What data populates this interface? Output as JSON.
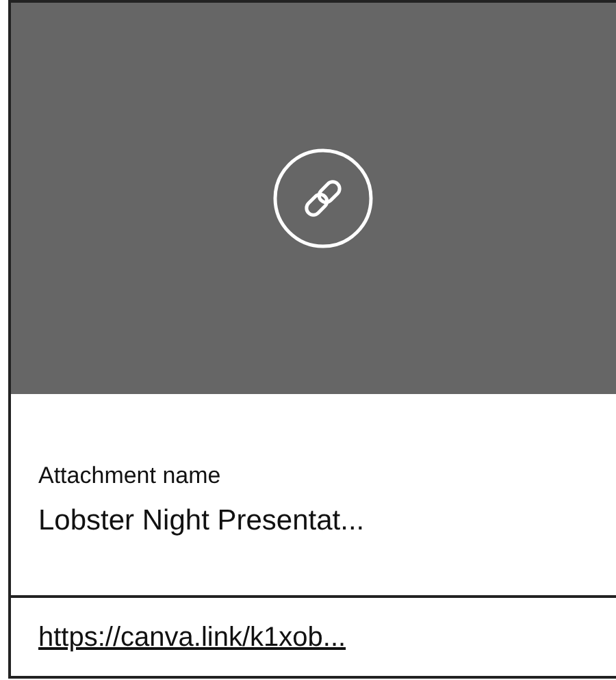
{
  "attachment": {
    "label": "Attachment name",
    "name": "Lobster Night Presentat...",
    "link": "https://canva.link/k1xob..."
  }
}
